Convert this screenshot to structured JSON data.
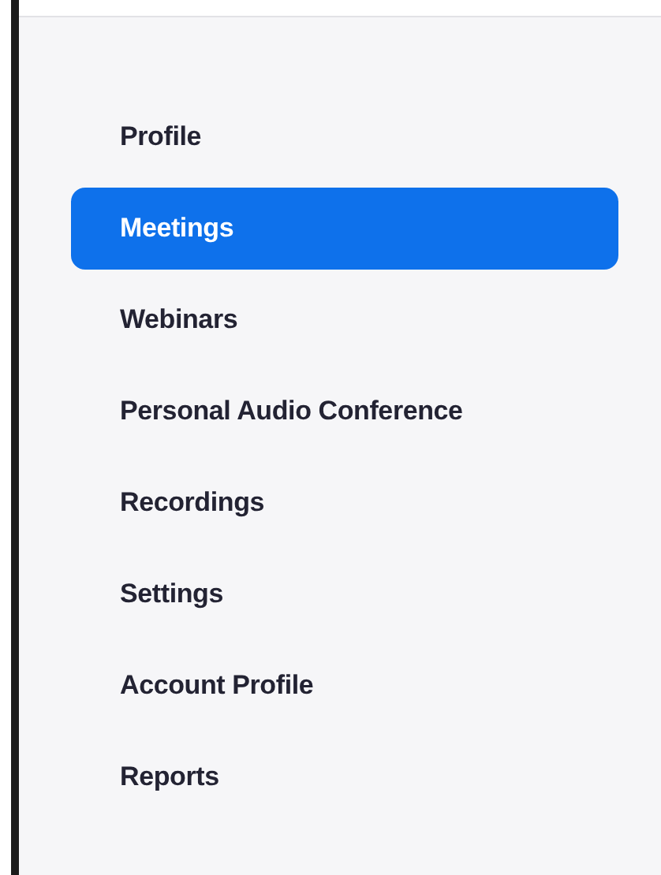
{
  "sidebar": {
    "items": [
      {
        "label": "Profile",
        "selected": false
      },
      {
        "label": "Meetings",
        "selected": true
      },
      {
        "label": "Webinars",
        "selected": false
      },
      {
        "label": "Personal Audio Conference",
        "selected": false
      },
      {
        "label": "Recordings",
        "selected": false
      },
      {
        "label": "Settings",
        "selected": false
      },
      {
        "label": "Account Profile",
        "selected": false
      },
      {
        "label": "Reports",
        "selected": false
      }
    ]
  }
}
